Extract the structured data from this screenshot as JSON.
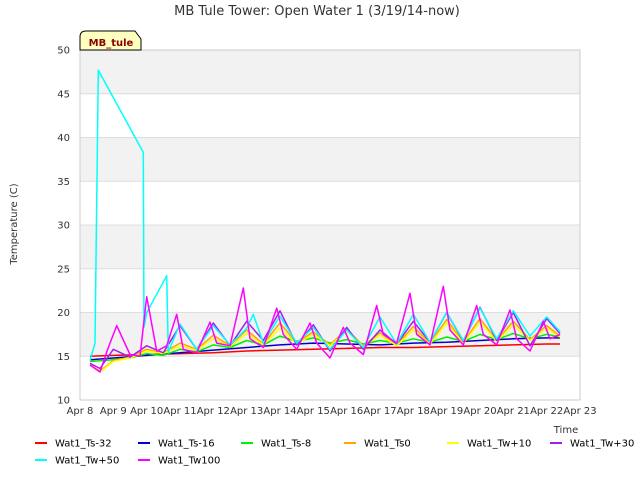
{
  "chart_data": {
    "type": "line",
    "title": "MB Tule Tower: Open Water 1 (3/19/14-now)",
    "badge": "MB_tule",
    "ylabel": "Temperature (C)",
    "xlabel": "Time",
    "ylim": [
      10,
      50
    ],
    "yticks": [
      "10",
      "15",
      "20",
      "25",
      "30",
      "35",
      "40",
      "45",
      "50"
    ],
    "xlim": [
      8,
      23
    ],
    "xticks": [
      "Apr 8",
      "Apr 9",
      "Apr 10",
      "Apr 11",
      "Apr 12",
      "Apr 13",
      "Apr 14",
      "Apr 15",
      "Apr 16",
      "Apr 17",
      "Apr 18",
      "Apr 19",
      "Apr 20",
      "Apr 21",
      "Apr 22",
      "Apr 23"
    ],
    "grid": true,
    "legend_position": "bottom",
    "series": [
      {
        "name": "Wat1_Ts-32",
        "color": "#ff0000",
        "x": [
          8.3,
          9,
          10,
          11,
          12,
          13,
          14,
          15,
          16,
          17,
          18,
          19,
          20,
          21,
          22,
          22.4
        ],
        "y": [
          15.0,
          15.1,
          15.2,
          15.3,
          15.4,
          15.6,
          15.7,
          15.8,
          15.9,
          16.0,
          16.0,
          16.1,
          16.2,
          16.3,
          16.4,
          16.4
        ]
      },
      {
        "name": "Wat1_Ts-16",
        "color": "#0000cc",
        "x": [
          8.3,
          9,
          10,
          11,
          12,
          13,
          14,
          15,
          16,
          17,
          18,
          19,
          20,
          21,
          22,
          22.4
        ],
        "y": [
          14.6,
          14.8,
          15.1,
          15.4,
          15.7,
          16.0,
          16.3,
          16.5,
          16.4,
          16.3,
          16.5,
          16.6,
          16.8,
          17.0,
          17.1,
          17.1
        ]
      },
      {
        "name": "Wat1_Ts-8",
        "color": "#00ee00",
        "x": [
          8.3,
          9,
          9.5,
          10,
          10.5,
          11,
          11.5,
          12,
          12.5,
          13,
          13.5,
          14,
          14.5,
          15,
          15.5,
          16,
          16.5,
          17,
          17.5,
          18,
          18.5,
          19,
          19.5,
          20,
          20.5,
          21,
          21.5,
          22,
          22.4
        ],
        "y": [
          14.4,
          14.6,
          14.8,
          15.3,
          15.1,
          15.8,
          15.5,
          16.3,
          16.0,
          16.8,
          16.3,
          17.3,
          16.7,
          17.1,
          16.5,
          16.9,
          16.4,
          16.8,
          16.5,
          17.0,
          16.6,
          17.2,
          16.7,
          17.5,
          16.9,
          17.6,
          17.0,
          17.5,
          17.2
        ]
      },
      {
        "name": "Wat1_Ts0",
        "color": "#ffa500",
        "x": [
          8.3,
          8.6,
          9,
          9.5,
          10,
          10.5,
          11,
          11.5,
          12,
          12.5,
          13,
          13.5,
          14,
          14.5,
          15,
          15.5,
          16,
          16.5,
          17,
          17.5,
          18,
          18.5,
          19,
          19.5,
          20,
          20.5,
          21,
          21.5,
          22,
          22.4
        ],
        "y": [
          14.0,
          13.3,
          14.5,
          14.9,
          15.8,
          15.4,
          16.5,
          15.8,
          17.4,
          16.2,
          18.0,
          16.4,
          18.8,
          16.5,
          17.8,
          16.3,
          18.1,
          16.2,
          17.7,
          16.3,
          18.4,
          16.5,
          19.2,
          16.6,
          19.3,
          16.8,
          19.0,
          16.9,
          18.5,
          17.3
        ]
      },
      {
        "name": "Wat1_Tw+10",
        "color": "#ffff00",
        "x": [
          8.3,
          8.6,
          9,
          9.5,
          10,
          10.5,
          11,
          11.5,
          12,
          12.5,
          13,
          13.5,
          14,
          14.5,
          15,
          15.5,
          16,
          16.5,
          17,
          17.5,
          18,
          18.5,
          19,
          19.5,
          20,
          20.5,
          21,
          21.5,
          22,
          22.4
        ],
        "y": [
          14.0,
          13.2,
          14.4,
          14.8,
          15.6,
          15.3,
          16.2,
          15.7,
          17.0,
          16.1,
          17.6,
          16.3,
          18.2,
          16.4,
          17.5,
          16.2,
          17.9,
          16.1,
          17.4,
          16.2,
          18.0,
          16.4,
          18.8,
          16.5,
          18.9,
          16.7,
          18.6,
          16.8,
          18.2,
          17.2
        ]
      },
      {
        "name": "Wat1_Tw+30",
        "color": "#a020f0",
        "x": [
          8.3,
          8.6,
          9,
          9.5,
          10,
          10.5,
          11,
          11.5,
          12,
          12.5,
          13,
          13.5,
          14,
          14.5,
          15,
          15.5,
          16,
          16.5,
          17,
          17.5,
          18,
          18.5,
          19,
          19.5,
          20,
          20.5,
          21,
          21.5,
          22,
          22.4
        ],
        "y": [
          14.2,
          13.6,
          15.8,
          14.9,
          16.2,
          15.4,
          18.5,
          15.8,
          18.8,
          16.2,
          19.0,
          16.8,
          20.2,
          16.3,
          18.6,
          15.6,
          18.3,
          15.8,
          18.0,
          16.4,
          19.0,
          16.6,
          20.0,
          16.7,
          20.6,
          16.8,
          20.0,
          16.2,
          19.3,
          17.6
        ]
      },
      {
        "name": "Wat1_Tw+50",
        "color": "#00ffff",
        "x": [
          8.3,
          8.45,
          8.55,
          9.9,
          9.92,
          10.0,
          10.6,
          10.65,
          11,
          11.5,
          12,
          12.5,
          13,
          13.2,
          13.5,
          14,
          14.5,
          15,
          15.5,
          16,
          16.5,
          17,
          17.5,
          18,
          18.5,
          19,
          19.5,
          20,
          20.5,
          21,
          21.5,
          22,
          22.4
        ],
        "y": [
          14.5,
          16.5,
          47.7,
          38.3,
          18.3,
          20.0,
          24.2,
          15.5,
          18.7,
          15.8,
          18.5,
          16.3,
          18.2,
          19.8,
          16.5,
          19.6,
          16.5,
          18.3,
          15.8,
          18.0,
          16.0,
          19.5,
          16.4,
          19.8,
          16.6,
          20.0,
          16.8,
          20.5,
          17.0,
          20.2,
          17.3,
          19.5,
          17.8
        ]
      },
      {
        "name": "Wat1_Tw100",
        "color": "#ff00ff",
        "x": [
          8.3,
          8.6,
          8.8,
          9.1,
          9.5,
          9.8,
          10.0,
          10.3,
          10.6,
          10.9,
          11.1,
          11.5,
          11.9,
          12.1,
          12.5,
          12.9,
          13.1,
          13.5,
          13.9,
          14.1,
          14.5,
          14.9,
          15.1,
          15.5,
          15.9,
          16.1,
          16.5,
          16.9,
          17.1,
          17.5,
          17.9,
          18.1,
          18.5,
          18.9,
          19.1,
          19.5,
          19.9,
          20.1,
          20.5,
          20.9,
          21.1,
          21.5,
          21.9,
          22.1,
          22.4
        ],
        "y": [
          14.0,
          13.2,
          15.5,
          18.5,
          15.2,
          15.0,
          21.8,
          15.6,
          16.2,
          19.8,
          15.8,
          15.4,
          18.9,
          16.5,
          16.2,
          22.8,
          17.0,
          16.0,
          20.5,
          17.5,
          15.8,
          18.8,
          16.5,
          14.8,
          18.3,
          16.5,
          15.2,
          20.8,
          17.5,
          16.5,
          22.2,
          17.5,
          16.3,
          23.0,
          18.0,
          16.3,
          20.8,
          17.5,
          16.3,
          20.3,
          17.0,
          15.6,
          19.0,
          17.0,
          17.5
        ]
      }
    ]
  }
}
